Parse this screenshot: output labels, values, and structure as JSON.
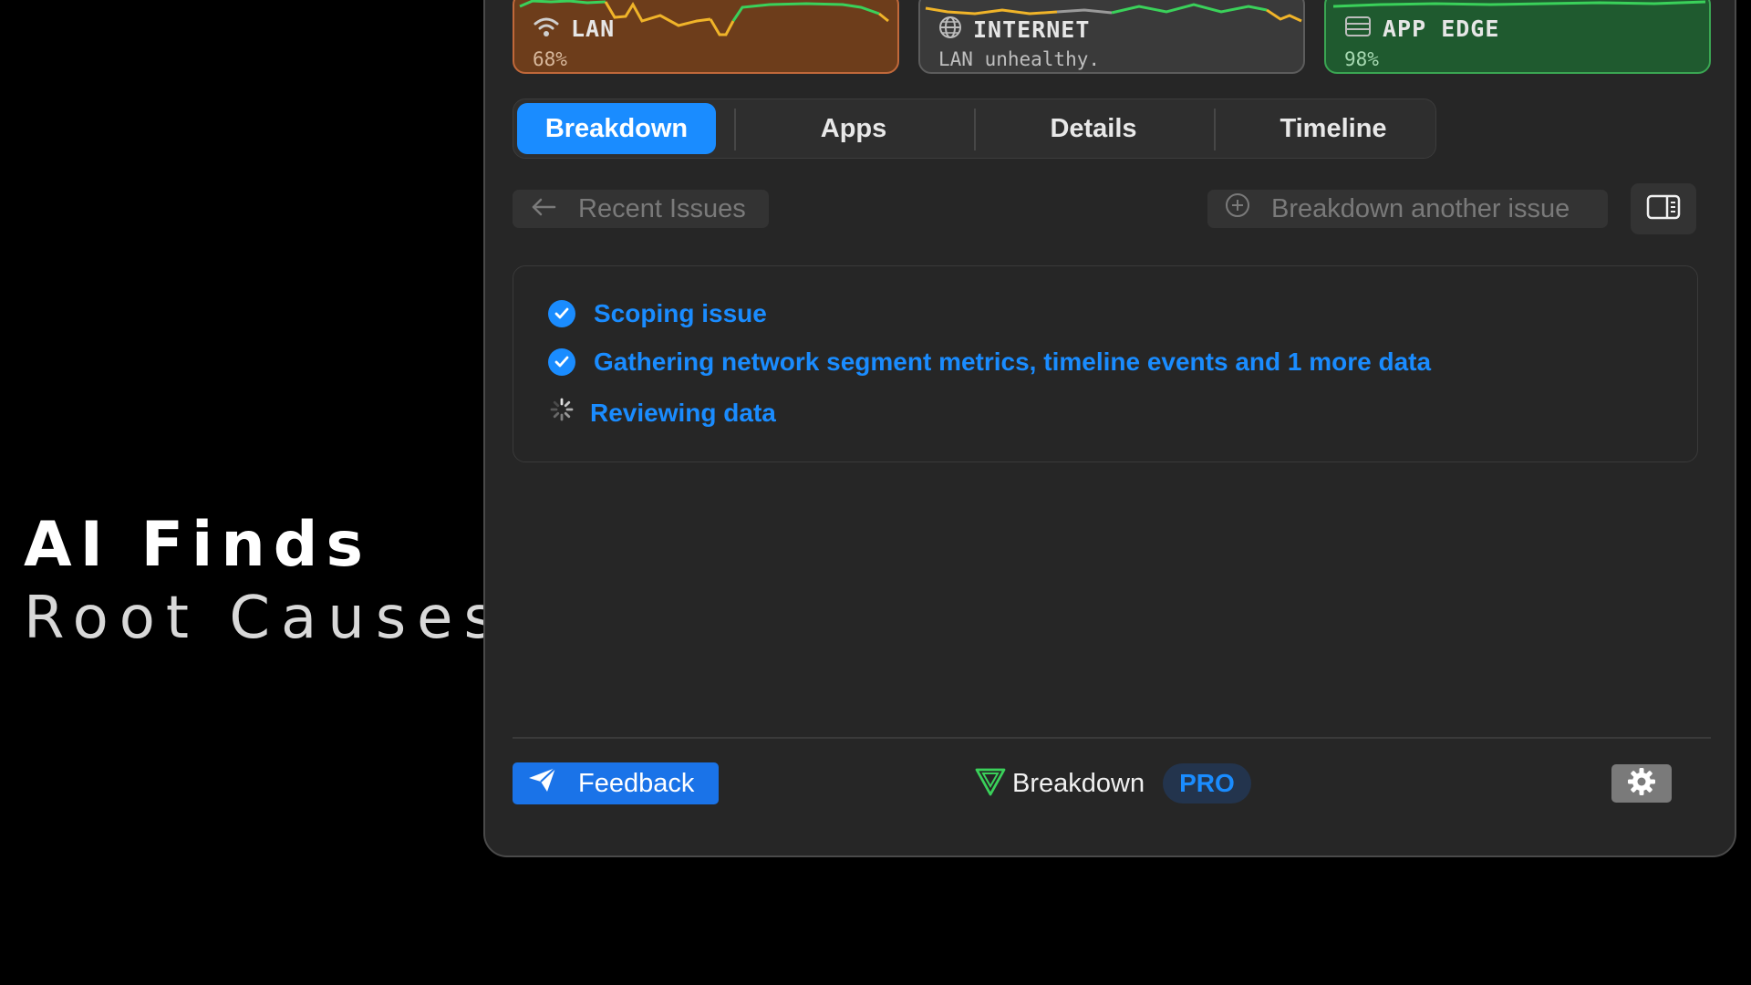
{
  "promo": {
    "title": "AI Finds",
    "subtitle": "Root Causes"
  },
  "status_cards": {
    "lan": {
      "title": "LAN",
      "value": "68%",
      "icon": "wifi-icon",
      "color": "#c0683a"
    },
    "internet": {
      "title": "INTERNET",
      "status": "LAN unhealthy.",
      "icon": "globe-icon",
      "color": "#5c5c5c"
    },
    "app_edge": {
      "title": "APP EDGE",
      "value": "98%",
      "icon": "server-icon",
      "color": "#3aa552"
    }
  },
  "tabs": [
    {
      "label": "Breakdown",
      "active": true
    },
    {
      "label": "Apps",
      "active": false
    },
    {
      "label": "Details",
      "active": false
    },
    {
      "label": "Timeline",
      "active": false
    }
  ],
  "toolbar": {
    "recent_issues": "Recent Issues",
    "breakdown_another": "Breakdown another issue",
    "sidebar_icon": "sidebar-toggle-icon"
  },
  "steps": [
    {
      "label": "Scoping issue",
      "state": "done"
    },
    {
      "label": "Gathering network segment metrics, timeline events and 1 more data",
      "state": "done"
    },
    {
      "label": "Reviewing data",
      "state": "in-progress"
    }
  ],
  "footer": {
    "feedback": "Feedback",
    "brand": "Breakdown",
    "badge": "PRO",
    "settings_icon": "gear-icon"
  },
  "colors": {
    "accent": "#1a8cff",
    "background": "#262626"
  }
}
